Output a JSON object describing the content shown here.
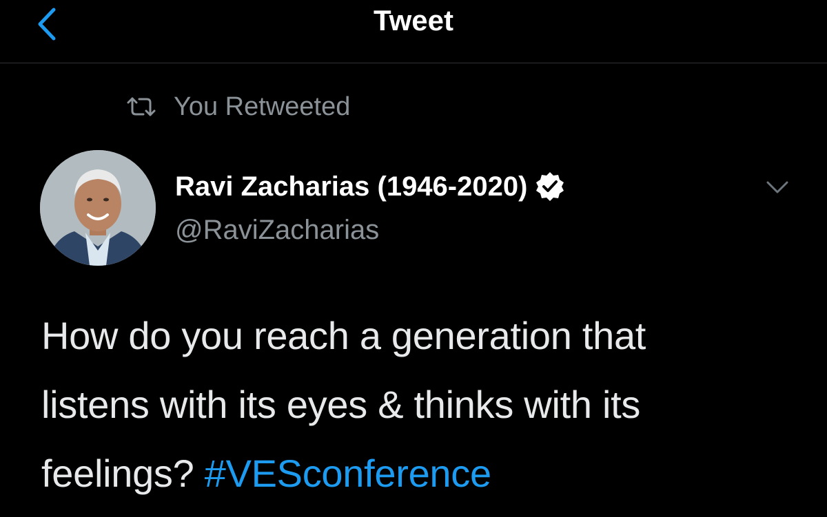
{
  "nav": {
    "title": "Tweet",
    "back_icon": "chevron-left-icon"
  },
  "social_context": {
    "text": "You Retweeted",
    "icon": "retweet-icon"
  },
  "author": {
    "name": "Ravi Zacharias (1946-2020)",
    "handle": "@RaviZacharias",
    "verified": true,
    "verified_icon": "verified-badge-icon",
    "more_icon": "chevron-down-icon"
  },
  "tweet": {
    "line1": "How do you reach a generation that",
    "line2": "listens with its eyes & thinks with its",
    "line3_text": "feelings? ",
    "hashtag": "#VESconference"
  },
  "colors": {
    "background": "#000000",
    "accent": "#1d9bf0",
    "secondary_text": "#8b9399",
    "primary_text": "#e7e9ea"
  }
}
